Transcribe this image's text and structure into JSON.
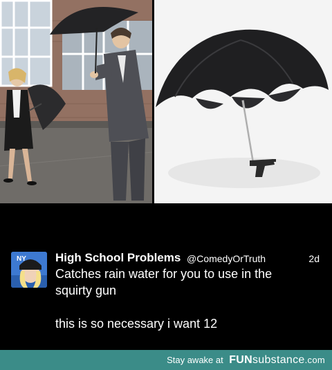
{
  "tweet": {
    "display_name": "High School Problems",
    "handle": "@ComedyOrTruth",
    "time": "2d",
    "lines": [
      "Catches rain water for you to use in the",
      "squirty gun",
      "this is so necessary i want 12"
    ]
  },
  "footer": {
    "tagline": "Stay awake at",
    "brand_bold": "FUN",
    "brand_rest": "substance",
    "brand_tld": ".com"
  },
  "avatar": {
    "letters": "NY"
  },
  "colors": {
    "footer_bg": "#3b8c88",
    "background": "#000000",
    "text": "#ffffff"
  }
}
